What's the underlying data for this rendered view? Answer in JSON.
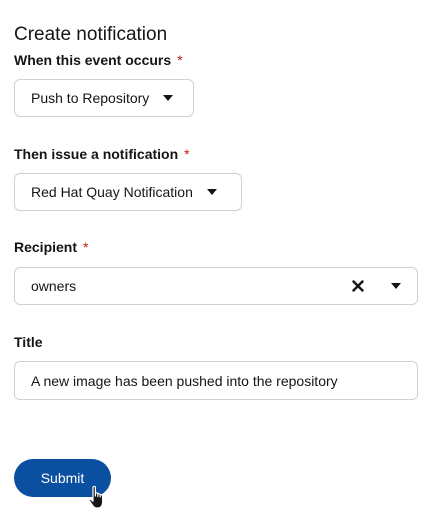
{
  "form": {
    "title": "Create notification",
    "event": {
      "label": "When this event occurs",
      "required_mark": "*",
      "selected": "Push to Repository"
    },
    "method": {
      "label": "Then issue a notification",
      "required_mark": "*",
      "selected": "Red Hat Quay Notification"
    },
    "recipient": {
      "label": "Recipient",
      "required_mark": "*",
      "value": "owners",
      "clear_icon": "close-icon",
      "toggle_icon": "caret-down-icon"
    },
    "title_field": {
      "label": "Title",
      "value": "A new image has been pushed into the repository"
    },
    "submit_label": "Submit"
  },
  "colors": {
    "primary": "#0b4fa0",
    "required": "#c9190b",
    "border": "#d2d2d2",
    "text": "#151515"
  },
  "cursor": {
    "icon": "pointer-hand-icon"
  }
}
